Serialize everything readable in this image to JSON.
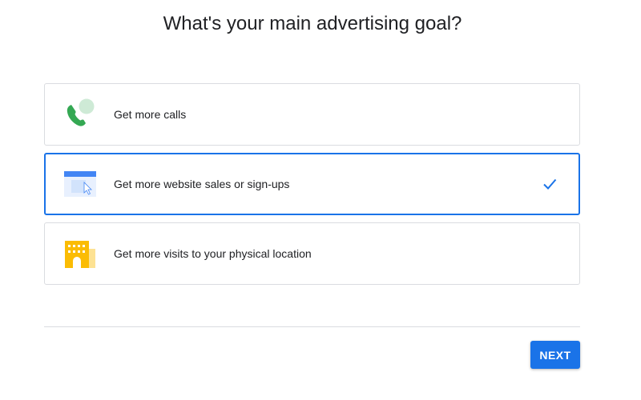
{
  "title": "What's your main advertising goal?",
  "options": [
    {
      "label": "Get more calls",
      "icon": "phone-icon",
      "selected": false
    },
    {
      "label": "Get more website sales or sign-ups",
      "icon": "website-icon",
      "selected": true
    },
    {
      "label": "Get more visits to your physical location",
      "icon": "storefront-icon",
      "selected": false
    }
  ],
  "next_label": "NEXT",
  "colors": {
    "accent": "#1a73e8",
    "phone": "#34a853",
    "bubble": "#ceead6",
    "store": "#fbbc04"
  }
}
